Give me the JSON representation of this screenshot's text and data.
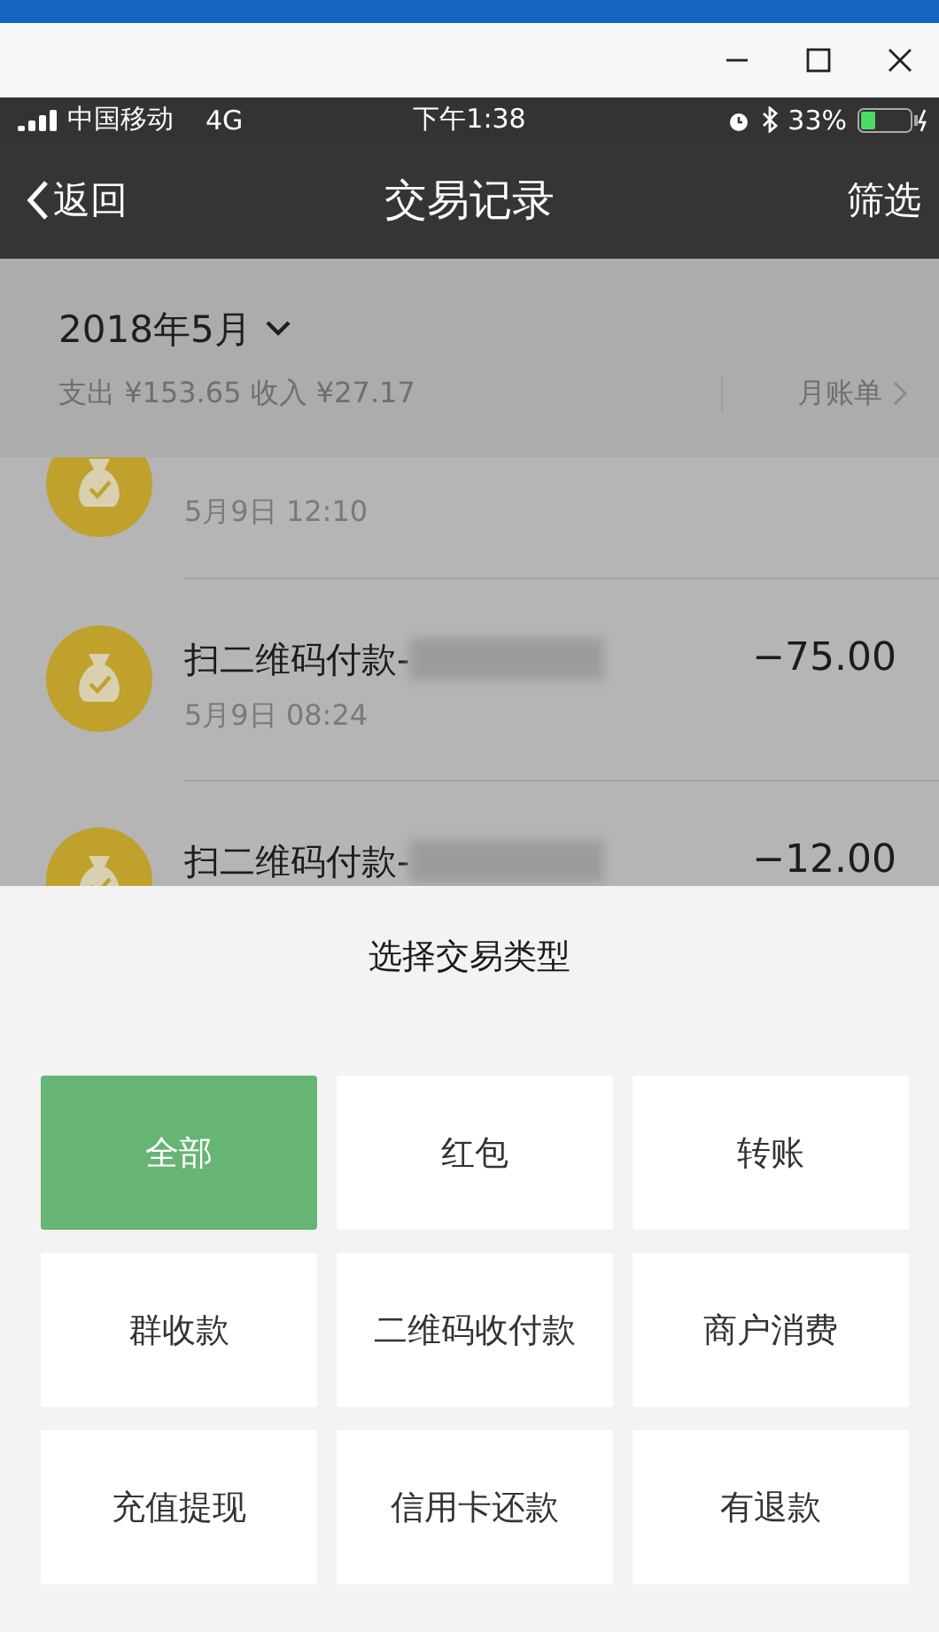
{
  "status_bar": {
    "carrier": "中国移动",
    "network": "4G",
    "time": "下午1:38",
    "battery": "33%"
  },
  "nav": {
    "back": "返回",
    "title": "交易记录",
    "action": "筛选"
  },
  "summary": {
    "month": "2018年5月",
    "totals": "支出 ¥153.65 收入 ¥27.17",
    "bill_link": "月账单"
  },
  "transactions": [
    {
      "date": "5月9日 12:10"
    },
    {
      "title": "扫二维码付款-",
      "amount": "−75.00",
      "date": "5月9日 08:24"
    },
    {
      "title": "扫二维码付款-",
      "amount": "−12.00"
    }
  ],
  "sheet": {
    "title": "选择交易类型",
    "options": [
      {
        "label": "全部",
        "selected": true
      },
      {
        "label": "红包",
        "selected": false
      },
      {
        "label": "转账",
        "selected": false
      },
      {
        "label": "群收款",
        "selected": false
      },
      {
        "label": "二维码收付款",
        "selected": false
      },
      {
        "label": "商户消费",
        "selected": false
      },
      {
        "label": "充值提现",
        "selected": false
      },
      {
        "label": "信用卡还款",
        "selected": false
      },
      {
        "label": "有退款",
        "selected": false
      }
    ]
  }
}
